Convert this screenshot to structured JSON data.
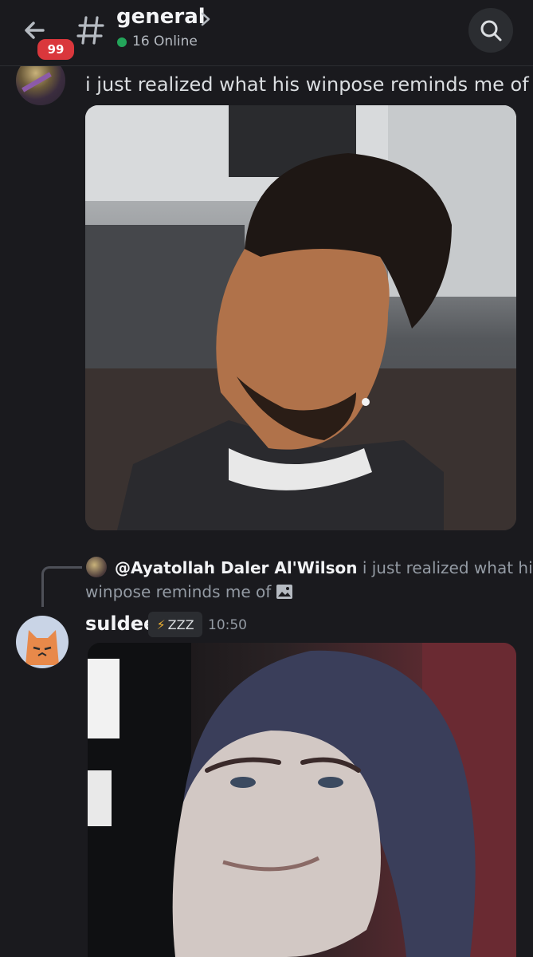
{
  "header": {
    "back_icon": "arrow-left-icon",
    "unread_badge": "99",
    "channel_icon": "hash-icon",
    "channel_name": "general",
    "online_count": "16 Online",
    "online_color": "#23a55a",
    "search_icon": "search-icon"
  },
  "messages": [
    {
      "text": "i just realized what his winpose reminds me of",
      "attachment": "image"
    },
    {
      "reply": {
        "user": "@Ayatollah Daler Al'Wilson",
        "content_line1": "i just realized what his",
        "content_line2": "winpose reminds me of"
      },
      "author": "suldee",
      "tag": "ZZZ",
      "timestamp": "10:50",
      "attachment": "image"
    }
  ],
  "colors": {
    "background": "#1a1a1e",
    "badge": "#da373c",
    "tag_bolt": "#f0b232"
  }
}
